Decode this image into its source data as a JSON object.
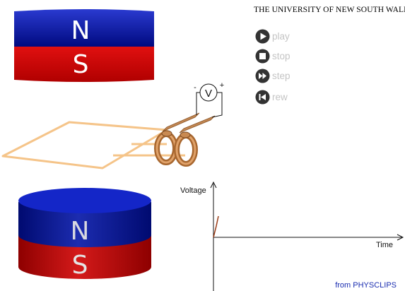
{
  "header": {
    "title": "THE UNIVERSITY OF NEW SOUTH WALES"
  },
  "controls": [
    {
      "id": "play",
      "label": "play",
      "icon": "play-icon"
    },
    {
      "id": "stop",
      "label": "stop",
      "icon": "stop-icon"
    },
    {
      "id": "step",
      "label": "step",
      "icon": "step-icon"
    },
    {
      "id": "rew",
      "label": "rew",
      "icon": "rewind-icon"
    }
  ],
  "magnets": {
    "top": {
      "north_label": "N",
      "south_label": "S"
    },
    "bottom": {
      "north_label": "N",
      "south_label": "S"
    }
  },
  "voltmeter": {
    "symbol": "V",
    "minus_label": "-",
    "plus_label": "+"
  },
  "graph": {
    "ylabel": "Voltage",
    "xlabel": "Time"
  },
  "credit": "from PHYSCLIPS",
  "colors": {
    "north": "#000e8c",
    "south": "#c80000",
    "copper": "#c98a52",
    "loop": "#f5c489",
    "control_icon": "#333333",
    "control_text": "#c4c4c4",
    "trace": "#9a3a14",
    "credit": "#1a2db0"
  }
}
